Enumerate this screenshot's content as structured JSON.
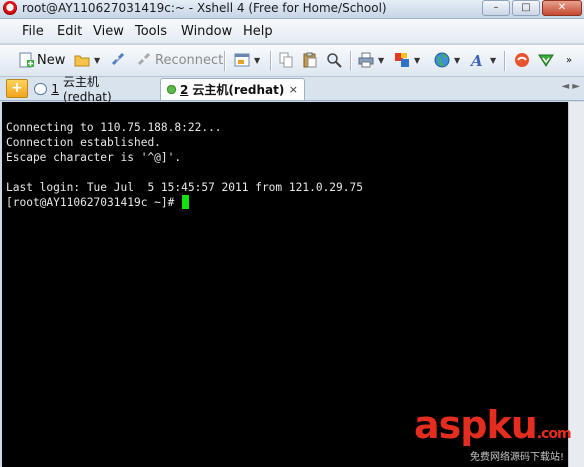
{
  "window": {
    "title": "root@AY110627031419c:~ - Xshell 4 (Free for Home/School)",
    "buttons": [
      "–",
      "□",
      "✕"
    ]
  },
  "menu": [
    "File",
    "Edit",
    "View",
    "Tools",
    "Window",
    "Help"
  ],
  "toolbar": {
    "new_label": "New",
    "reconnect_label": "Reconnect"
  },
  "tabs": {
    "add_symbol": "+",
    "items": [
      {
        "number": "1",
        "label": "云主机(redhat)"
      },
      {
        "number": "2",
        "label": "云主机(redhat)",
        "close": "×"
      }
    ],
    "nav": "◄ ►"
  },
  "terminal": {
    "lines": [
      "Connecting to 110.75.188.8:22...",
      "Connection established.",
      "Escape character is '^@]'.",
      "",
      "Last login: Tue Jul  5 15:45:57 2011 from 121.0.29.75",
      "[root@AY110627031419c ~]#"
    ]
  },
  "watermark": {
    "main": "asp",
    "accent": "ku",
    "tail": ".com",
    "sub": "免费网络源码下载站!"
  },
  "colors": {
    "terminal_bg": "#000000",
    "terminal_fg": "#e8e8e8",
    "cursor": "#12e012",
    "watermark": "#e52d1f"
  }
}
